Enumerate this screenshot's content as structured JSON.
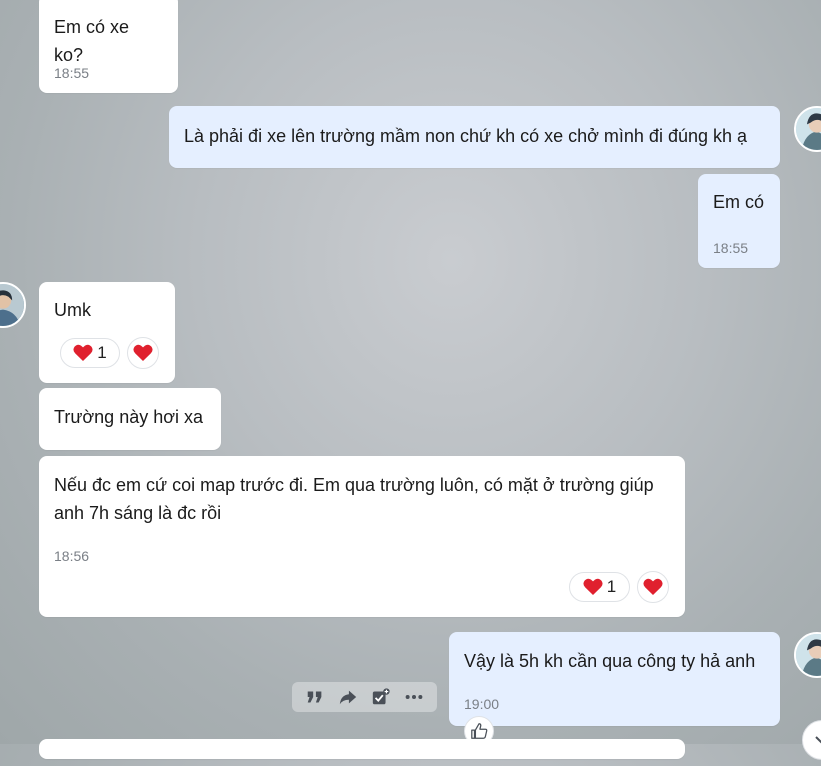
{
  "messages": [
    {
      "id": "m1",
      "text": "Em có xe ko?",
      "time": "18:55"
    },
    {
      "id": "m2",
      "text": "Là phải đi xe lên trường mầm non chứ kh có xe chở mình đi đúng kh ạ"
    },
    {
      "id": "m3",
      "text": "Em có",
      "time": "18:55"
    },
    {
      "id": "m4",
      "text": "Umk",
      "reaction_count": "1"
    },
    {
      "id": "m5",
      "text": "Trường này hơi xa"
    },
    {
      "id": "m6",
      "text": "Nếu đc em cứ coi map trước đi. Em qua trường luôn, có mặt ở trường giúp anh 7h sáng là đc rồi",
      "time": "18:56",
      "reaction_count": "1"
    },
    {
      "id": "m7",
      "text": "Vậy là 5h kh cần qua công ty hả anh",
      "time": "19:00"
    }
  ],
  "colors": {
    "incoming_bubble": "#ffffff",
    "outgoing_bubble": "#e5efff",
    "heart": "#e0202e",
    "time_text": "#7a7f86"
  },
  "icons": {
    "reaction": "heart-icon",
    "toolbar": [
      "quote-icon",
      "forward-icon",
      "task-icon",
      "more-icon"
    ],
    "like": "thumbs-up-icon",
    "scroll": "chevron-down-icon"
  }
}
